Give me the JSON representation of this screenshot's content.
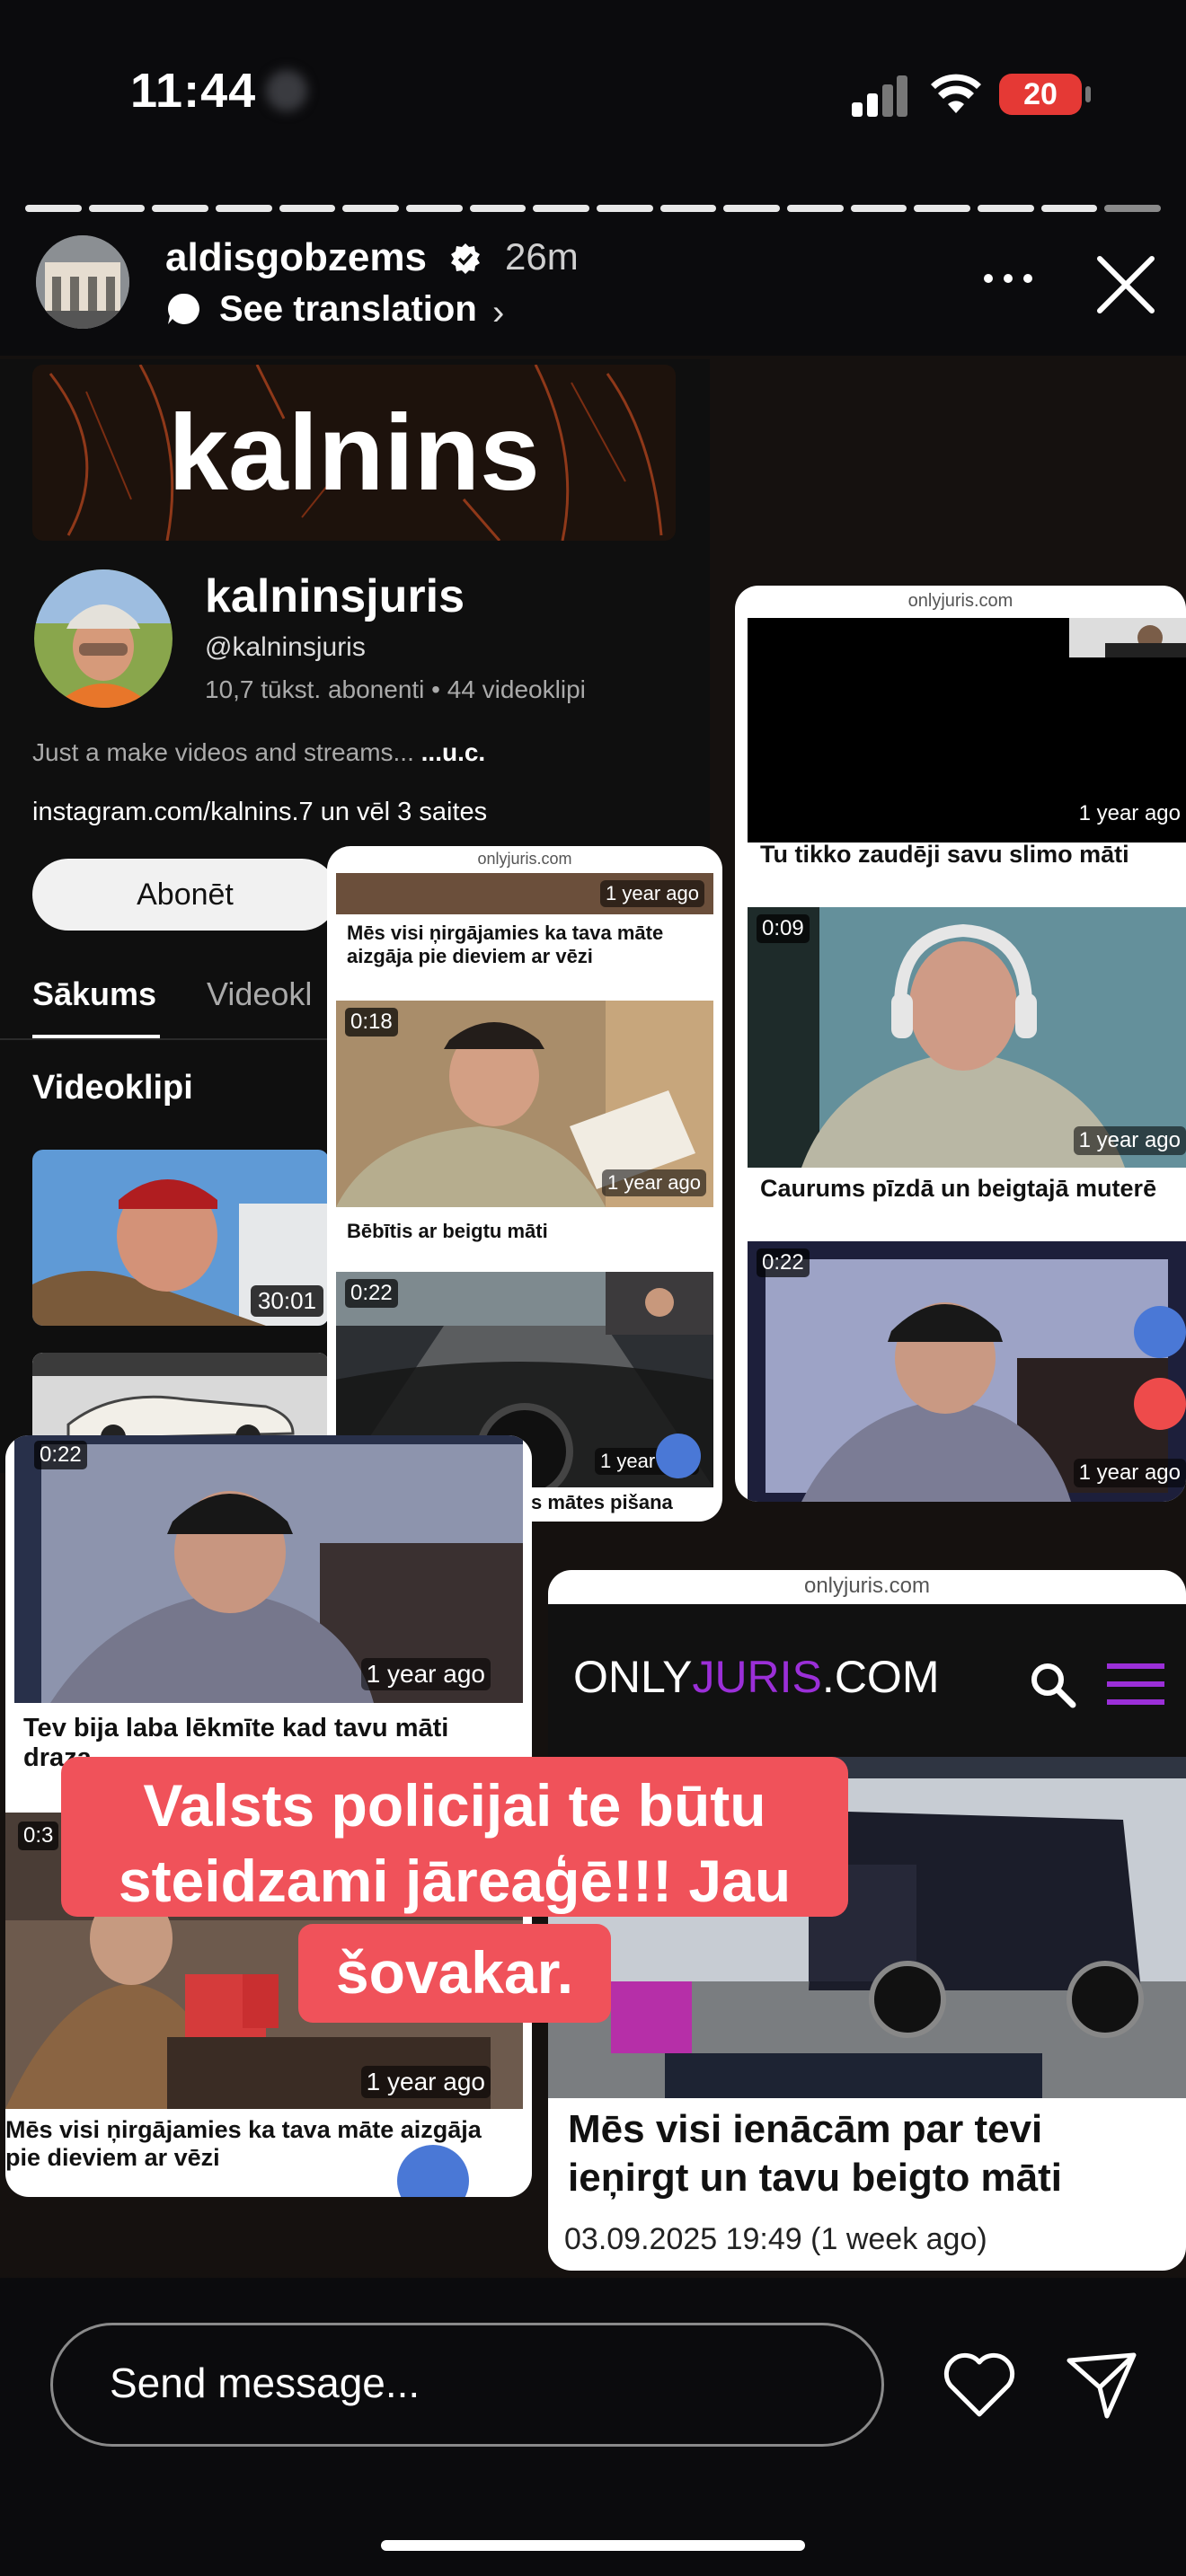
{
  "status_bar": {
    "time": "11:44",
    "battery": "20"
  },
  "story": {
    "username": "aldisgobzems",
    "time_ago": "26m",
    "see_translation": "See translation",
    "progress_segments": 18,
    "progress_active": 17
  },
  "channel": {
    "banner": "kalnins",
    "name": "kalninsjuris",
    "handle": "@kalninsjuris",
    "stats": "10,7 tūkst. abonenti • 44 videoklipi",
    "description": "Just a make videos and streams...",
    "description_more": "...u.c.",
    "link": "instagram.com/kalnins.7 un vēl 3 saites",
    "subscribe": "Abonēt",
    "tab_home": "Sākums",
    "tab_videos": "Videokl",
    "section": "Videoklipi",
    "thumb_a_duration": "30:01"
  },
  "card_center": {
    "url": "onlyjuris.com",
    "item1_ago": "1 year ago",
    "item1_title": "Mēs visi ņirgājamies ka tava māte aizgāja pie dieviem ar vēzi",
    "item2_duration": "0:18",
    "item2_ago": "1 year ago",
    "item2_title": "Bēbītis ar beigtu māti",
    "item3_duration": "0:22",
    "item3_ago": "1 year ago",
    "item3_title": "Free content – Tavas mātes pišana"
  },
  "card_right": {
    "url": "onlyjuris.com",
    "item1_ago": "1 year ago",
    "item1_title": "Tu tikko zaudēji savu slimo māti",
    "item2_duration": "0:09",
    "item2_ago": "1 year ago",
    "item2_title": "Caurums pīzdā un beigtajā muterē",
    "item3_duration": "0:22",
    "item3_ago": "1 year ago"
  },
  "card_left": {
    "item1_duration": "0:22",
    "item1_ago": "1 year ago",
    "item1_title": "Tev bija laba lēkmīte kad tavu māti draza",
    "item2_duration": "0:3",
    "item2_ago": "1 year ago",
    "item2_title": "Mēs visi ņirgājamies ka tava māte aizgāja pie dieviem ar vēzi"
  },
  "card_bottom": {
    "url": "onlyjuris.com",
    "brand_only": "ONLY",
    "brand_juris": "JURIS",
    "brand_com": ".COM",
    "title": "Mēs visi ienācām par tevi ieņirgt un tavu beigto māti",
    "date": "03.09.2025 19:49 (1 week ago)"
  },
  "caption": {
    "line1": "Valsts policijai te būtu",
    "line2": "steidzami jāreaģē!!! Jau",
    "line3": "šovakar."
  },
  "composer": {
    "placeholder": "Send message..."
  },
  "colors": {
    "caption_bg": "#f0525a",
    "brand_accent": "#9b2fd8",
    "battery": "#e53935"
  }
}
